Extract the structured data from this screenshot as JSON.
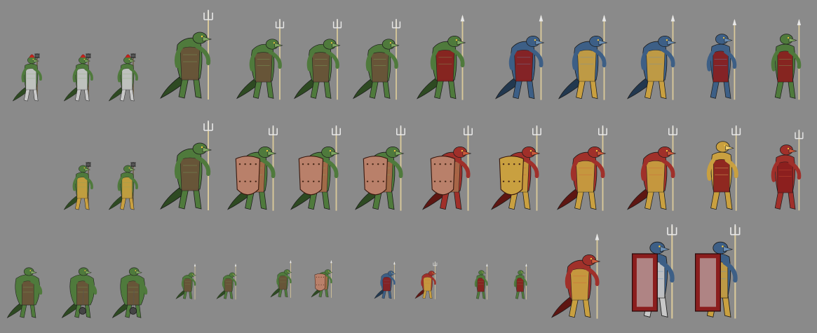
{
  "sheet": {
    "background": "#8a8a8a"
  },
  "palette": {
    "green": {
      "skin": "#4f7a3c",
      "dark": "#2e4a22",
      "light": "#7fa860"
    },
    "blue": {
      "skin": "#3d5f86",
      "dark": "#22384f",
      "light": "#6b8fb5"
    },
    "red": {
      "skin": "#a0302a",
      "dark": "#5e1612",
      "light": "#d05a3a"
    },
    "gold": "#c9a040",
    "silver": "#c8c8c8",
    "bronze": "#a86a4a",
    "cloth_red": "#8b1e1e",
    "cloth_brown": "#6a5238",
    "crest": "#c4241c"
  },
  "rows": [
    {
      "name": "row-1",
      "sprites": [
        {
          "name": "armored-lizardman-flail-1",
          "skin": "green",
          "armor": "silver",
          "weapon": "flail",
          "crest": true,
          "pose": "stand"
        },
        {
          "name": "armored-lizardman-flail-2",
          "skin": "green",
          "armor": "silver",
          "weapon": "flail",
          "crest": true,
          "pose": "stand"
        },
        {
          "name": "armored-lizardman-flail-3",
          "skin": "green",
          "armor": "silver",
          "weapon": "flail",
          "crest": true,
          "pose": "stand"
        },
        {
          "name": "lizardman-trident-1",
          "skin": "green",
          "armor": "cloth_brown",
          "weapon": "trident",
          "pose": "hunch"
        },
        {
          "name": "lizardman-trident-2",
          "skin": "green",
          "armor": "cloth_brown",
          "weapon": "trident",
          "pose": "hunch"
        },
        {
          "name": "lizardman-trident-3",
          "skin": "green",
          "armor": "cloth_brown",
          "weapon": "trident",
          "pose": "hunch"
        },
        {
          "name": "lizardman-trident-4",
          "skin": "green",
          "armor": "cloth_brown",
          "weapon": "trident",
          "pose": "hunch"
        },
        {
          "name": "lizardman-spear-red-cloth-1",
          "skin": "green",
          "armor": "cloth_red",
          "weapon": "spear",
          "pose": "hunch"
        },
        {
          "name": "lizardman-spear-red-cloth-2",
          "skin": "blue",
          "armor": "cloth_red",
          "weapon": "spear",
          "pose": "hunch"
        },
        {
          "name": "lizardman-gold-armor-1",
          "skin": "blue",
          "armor": "gold",
          "weapon": "spear",
          "pose": "hunch"
        },
        {
          "name": "lizardman-gold-armor-2",
          "skin": "blue",
          "armor": "gold",
          "weapon": "spear",
          "pose": "hunch"
        },
        {
          "name": "lizardman-spear-upright-1",
          "skin": "blue",
          "armor": "cloth_red",
          "weapon": "spear",
          "pose": "upright"
        },
        {
          "name": "lizardman-spear-upright-2",
          "skin": "green",
          "armor": "cloth_red",
          "weapon": "spear",
          "pose": "upright"
        }
      ]
    },
    {
      "name": "row-2",
      "sprites": [
        {
          "name": "gold-armored-lizardman-mace-1",
          "skin": "green",
          "armor": "gold",
          "weapon": "mace",
          "pose": "stand"
        },
        {
          "name": "gold-armored-lizardman-mace-2",
          "skin": "green",
          "armor": "gold",
          "weapon": "mace",
          "pose": "stand"
        },
        {
          "name": "lizardman-trident-finned",
          "skin": "green",
          "armor": "cloth_brown",
          "weapon": "trident",
          "pose": "hunch"
        },
        {
          "name": "lizardman-shield-bronze-1",
          "skin": "green",
          "armor": "bronze",
          "weapon": "trident",
          "shield": "bronze",
          "pose": "hunch"
        },
        {
          "name": "lizardman-shield-bronze-2",
          "skin": "green",
          "armor": "bronze",
          "weapon": "trident",
          "shield": "bronze",
          "pose": "hunch"
        },
        {
          "name": "lizardman-shield-bronze-3",
          "skin": "green",
          "armor": "bronze",
          "weapon": "trident",
          "shield": "bronze",
          "pose": "hunch"
        },
        {
          "name": "lizardman-shield-red-1",
          "skin": "red",
          "armor": "bronze",
          "weapon": "trident",
          "shield": "bronze",
          "pose": "hunch"
        },
        {
          "name": "lizardman-shield-gold-1",
          "skin": "red",
          "armor": "gold",
          "weapon": "trident",
          "shield": "gold",
          "pose": "hunch"
        },
        {
          "name": "lizardman-gold-armor-red-1",
          "skin": "red",
          "armor": "gold",
          "weapon": "trident",
          "pose": "hunch"
        },
        {
          "name": "lizardman-gold-armor-blue-1",
          "skin": "red",
          "armor": "gold",
          "weapon": "trident",
          "pose": "hunch"
        },
        {
          "name": "lizardman-trident-upright-1",
          "skin": "gold",
          "armor": "cloth_red",
          "weapon": "trident",
          "pose": "upright"
        },
        {
          "name": "lizardman-trident-upright-2",
          "skin": "red",
          "armor": "cloth_red",
          "weapon": "trident",
          "pose": "upright"
        }
      ]
    },
    {
      "name": "row-3",
      "sprites": [
        {
          "name": "brute-lizardman-1",
          "skin": "green",
          "armor": "cloth_brown",
          "weapon": "none",
          "pose": "brute"
        },
        {
          "name": "brute-lizardman-ball-chain-1",
          "skin": "green",
          "armor": "cloth_brown",
          "weapon": "ball",
          "pose": "brute"
        },
        {
          "name": "brute-lizardman-ball-chain-2",
          "skin": "green",
          "armor": "cloth_brown",
          "weapon": "ball",
          "pose": "brute"
        },
        {
          "name": "small-lizardman-1",
          "skin": "green",
          "armor": "cloth_brown",
          "weapon": "spear",
          "pose": "hunch"
        },
        {
          "name": "small-lizardman-2",
          "skin": "green",
          "armor": "cloth_brown",
          "weapon": "spear",
          "pose": "hunch"
        },
        {
          "name": "small-lizardman-3",
          "skin": "green",
          "armor": "cloth_brown",
          "weapon": "spear",
          "pose": "hunch"
        },
        {
          "name": "small-lizardman-4",
          "skin": "green",
          "armor": "bronze",
          "weapon": "spear",
          "shield": "bronze",
          "pose": "hunch"
        },
        {
          "name": "small-lizardman-5",
          "skin": "blue",
          "armor": "cloth_red",
          "weapon": "spear",
          "pose": "hunch"
        },
        {
          "name": "small-lizardman-6",
          "skin": "red",
          "armor": "gold",
          "weapon": "trident",
          "pose": "hunch"
        },
        {
          "name": "small-lizardman-7",
          "skin": "green",
          "armor": "cloth_red",
          "weapon": "spear",
          "pose": "upright"
        },
        {
          "name": "small-lizardman-8",
          "skin": "green",
          "armor": "cloth_red",
          "weapon": "spear",
          "pose": "upright"
        },
        {
          "name": "gold-winged-lizardman",
          "skin": "red",
          "armor": "gold",
          "weapon": "spear",
          "pose": "hunch"
        },
        {
          "name": "lizardman-tower-shield-1",
          "skin": "blue",
          "armor": "silver",
          "weapon": "trident",
          "shield": "tower",
          "pose": "upright"
        },
        {
          "name": "lizardman-tower-shield-2",
          "skin": "blue",
          "armor": "gold",
          "weapon": "trident",
          "shield": "tower",
          "pose": "upright"
        }
      ]
    }
  ]
}
